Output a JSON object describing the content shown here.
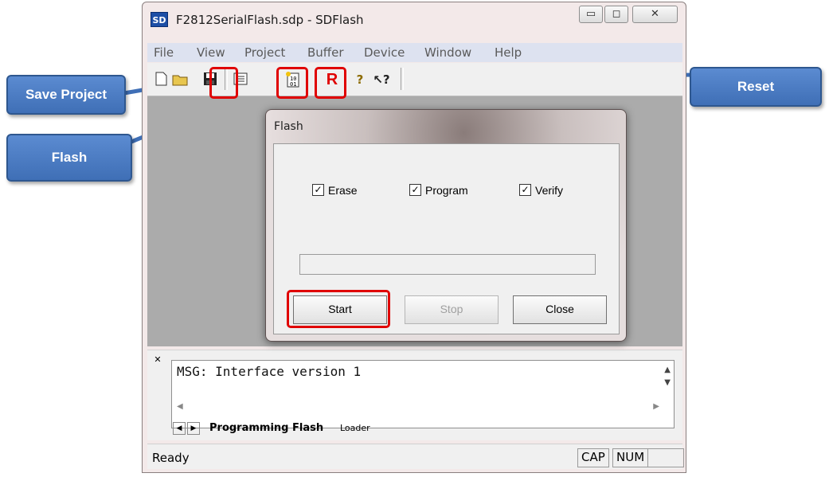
{
  "window": {
    "title": "F2812SerialFlash.sdp - SDFlash",
    "app_icon": "SD"
  },
  "caption_buttons": {
    "minimize": "▭",
    "maximize": "◻",
    "close": "✕"
  },
  "menu": [
    "File",
    "View",
    "Project",
    "Buffer",
    "Device",
    "Window",
    "Help"
  ],
  "toolbar": {
    "icons": [
      "new-file-icon",
      "open-folder-icon",
      "save-icon",
      "properties-icon",
      "flash-icon",
      "reset-icon",
      "help-icon",
      "context-help-icon"
    ],
    "reset_label": "R"
  },
  "dialog": {
    "title": "Flash",
    "options": [
      {
        "label": "Erase",
        "checked": true
      },
      {
        "label": "Program",
        "checked": true
      },
      {
        "label": "Verify",
        "checked": true
      }
    ],
    "progress": 0,
    "buttons": {
      "start": "Start",
      "stop": "Stop",
      "close": "Close"
    }
  },
  "output": {
    "message": "MSG: Interface version 1",
    "tabs": [
      "Programming Flash",
      "Loader"
    ],
    "active_tab": "Programming Flash"
  },
  "status": {
    "text": "Ready",
    "cap": "CAP",
    "num": "NUM"
  },
  "callouts": {
    "save_project": "Save Project",
    "flash": "Flash",
    "reset": "Reset"
  },
  "colors": {
    "callout": "#4a7bc4",
    "highlight": "#e00000"
  }
}
